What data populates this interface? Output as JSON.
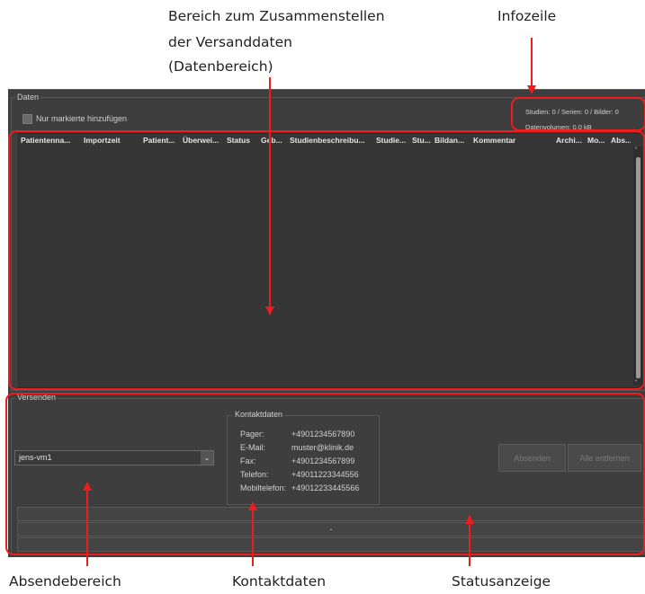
{
  "annotations": {
    "datenbereich": [
      "Bereich zum Zusammenstellen",
      "der Versanddaten",
      "(Datenbereich)"
    ],
    "infozeile": "Infozeile",
    "absendebereich": "Absendebereich",
    "kontaktdaten": "Kontaktdaten",
    "statusanzeige": "Statusanzeige",
    "arrow_color": "#ee1c1c"
  },
  "data_section": {
    "title": "Daten",
    "checkbox_label": "Nur markierte hinzufügen",
    "checkbox_checked": false,
    "info": {
      "line1": "Studien: 0  /  Serien: 0  /  Bilder: 0",
      "line2": "Datenvolumen: 0,0 kB"
    },
    "columns": [
      "Patientenna...",
      "Importzeit",
      "Patient...",
      "Überwei...",
      "Status",
      "Geb...",
      "Studienbeschreibu...",
      "Studie...",
      "Stu...",
      "Bildan...",
      "Kommentar",
      "Archi...",
      "Mo...",
      "Abs..."
    ],
    "rows": []
  },
  "send_section": {
    "title": "Versenden",
    "recipient_select": "jens-vm1",
    "contact": {
      "title": "Kontaktdaten",
      "rows": [
        {
          "label": "Pager:",
          "value": "+4901234567890"
        },
        {
          "label": "E-Mail:",
          "value": "muster@klinik.de"
        },
        {
          "label": "Fax:",
          "value": "+4901234567899"
        },
        {
          "label": "Telefon:",
          "value": "+49011223344556"
        },
        {
          "label": "Mobiltelefon:",
          "value": "+49012233445566"
        }
      ]
    },
    "buttons": {
      "send": "Absenden",
      "remove_all": "Alle entfernen"
    },
    "status": {
      "line1": "",
      "line2": "-",
      "line3": ""
    }
  }
}
